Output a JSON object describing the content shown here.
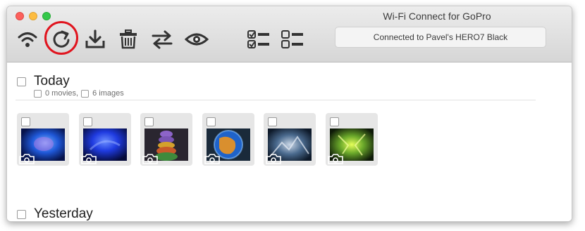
{
  "window": {
    "title": "Wi-Fi Connect for GoPro",
    "status": "Connected to Pavel's HERO7 Black"
  },
  "toolbar": {
    "icons": [
      "wifi-icon",
      "refresh-icon",
      "download-icon",
      "trash-icon",
      "sync-icon",
      "eye-icon",
      "select-all-icon",
      "deselect-all-icon"
    ],
    "highlight_color": "#e0141e"
  },
  "groups": [
    {
      "title": "Today",
      "movies_label": "0 movies,",
      "images_label": "6 images",
      "thumbnails": [
        {
          "icon": "camera-icon"
        },
        {
          "icon": "camera-icon"
        },
        {
          "icon": "camera-icon"
        },
        {
          "icon": "camera-icon"
        },
        {
          "icon": "camera-icon"
        },
        {
          "icon": "camera-icon"
        }
      ]
    },
    {
      "title": "Yesterday"
    }
  ]
}
